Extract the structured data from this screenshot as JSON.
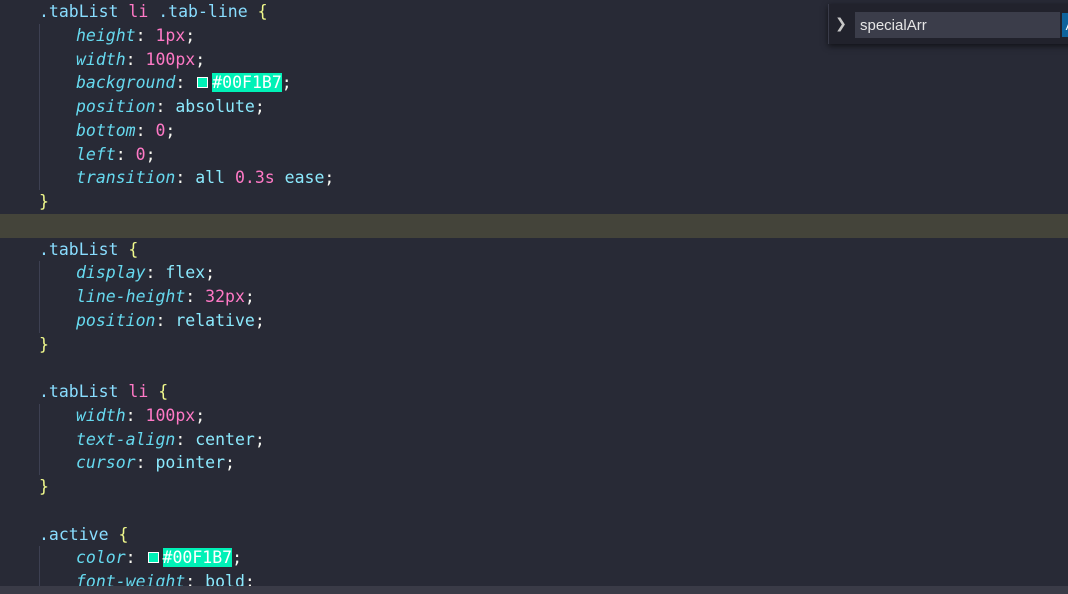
{
  "editor": {
    "lines": [
      {
        "indent": 1,
        "highlight": false,
        "tokens": [
          {
            "t": ".tabList",
            "c": "sel"
          },
          {
            "t": " ",
            "c": "punc"
          },
          {
            "t": "li",
            "c": "tag"
          },
          {
            "t": " ",
            "c": "punc"
          },
          {
            "t": ".tab-line",
            "c": "sel"
          },
          {
            "t": " ",
            "c": "punc"
          },
          {
            "t": "{",
            "c": "brace"
          }
        ]
      },
      {
        "indent": 2,
        "highlight": false,
        "tokens": [
          {
            "t": "height",
            "c": "prop"
          },
          {
            "t": ": ",
            "c": "punc"
          },
          {
            "t": "1px",
            "c": "num"
          },
          {
            "t": ";",
            "c": "punc"
          }
        ]
      },
      {
        "indent": 2,
        "highlight": false,
        "tokens": [
          {
            "t": "width",
            "c": "prop"
          },
          {
            "t": ": ",
            "c": "punc"
          },
          {
            "t": "100px",
            "c": "num"
          },
          {
            "t": ";",
            "c": "punc"
          }
        ]
      },
      {
        "indent": 2,
        "highlight": false,
        "tokens": [
          {
            "t": "background",
            "c": "prop"
          },
          {
            "t": ": ",
            "c": "punc"
          },
          {
            "t": "",
            "c": "swatch",
            "color": "#00F1B7"
          },
          {
            "t": "#00F1B7",
            "c": "colorval"
          },
          {
            "t": ";",
            "c": "punc"
          }
        ]
      },
      {
        "indent": 2,
        "highlight": false,
        "tokens": [
          {
            "t": "position",
            "c": "prop"
          },
          {
            "t": ": ",
            "c": "punc"
          },
          {
            "t": "absolute",
            "c": "kw"
          },
          {
            "t": ";",
            "c": "punc"
          }
        ]
      },
      {
        "indent": 2,
        "highlight": false,
        "tokens": [
          {
            "t": "bottom",
            "c": "prop"
          },
          {
            "t": ": ",
            "c": "punc"
          },
          {
            "t": "0",
            "c": "num"
          },
          {
            "t": ";",
            "c": "punc"
          }
        ]
      },
      {
        "indent": 2,
        "highlight": false,
        "tokens": [
          {
            "t": "left",
            "c": "prop"
          },
          {
            "t": ": ",
            "c": "punc"
          },
          {
            "t": "0",
            "c": "num"
          },
          {
            "t": ";",
            "c": "punc"
          }
        ]
      },
      {
        "indent": 2,
        "highlight": false,
        "tokens": [
          {
            "t": "transition",
            "c": "prop"
          },
          {
            "t": ": ",
            "c": "punc"
          },
          {
            "t": "all",
            "c": "kw"
          },
          {
            "t": " ",
            "c": "punc"
          },
          {
            "t": "0.3s",
            "c": "num"
          },
          {
            "t": " ",
            "c": "punc"
          },
          {
            "t": "ease",
            "c": "kw"
          },
          {
            "t": ";",
            "c": "punc"
          }
        ]
      },
      {
        "indent": 1,
        "highlight": false,
        "tokens": [
          {
            "t": "}",
            "c": "brace"
          }
        ]
      },
      {
        "indent": 0,
        "highlight": true,
        "tokens": []
      },
      {
        "indent": 1,
        "highlight": false,
        "tokens": [
          {
            "t": ".tabList",
            "c": "sel"
          },
          {
            "t": " ",
            "c": "punc"
          },
          {
            "t": "{",
            "c": "brace"
          }
        ]
      },
      {
        "indent": 2,
        "highlight": false,
        "tokens": [
          {
            "t": "display",
            "c": "prop"
          },
          {
            "t": ": ",
            "c": "punc"
          },
          {
            "t": "flex",
            "c": "kw"
          },
          {
            "t": ";",
            "c": "punc"
          }
        ]
      },
      {
        "indent": 2,
        "highlight": false,
        "tokens": [
          {
            "t": "line-height",
            "c": "prop"
          },
          {
            "t": ": ",
            "c": "punc"
          },
          {
            "t": "32px",
            "c": "num"
          },
          {
            "t": ";",
            "c": "punc"
          }
        ]
      },
      {
        "indent": 2,
        "highlight": false,
        "tokens": [
          {
            "t": "position",
            "c": "prop"
          },
          {
            "t": ": ",
            "c": "punc"
          },
          {
            "t": "relative",
            "c": "kw"
          },
          {
            "t": ";",
            "c": "punc"
          }
        ]
      },
      {
        "indent": 1,
        "highlight": false,
        "tokens": [
          {
            "t": "}",
            "c": "brace"
          }
        ]
      },
      {
        "indent": 0,
        "highlight": false,
        "tokens": []
      },
      {
        "indent": 1,
        "highlight": false,
        "tokens": [
          {
            "t": ".tabList",
            "c": "sel"
          },
          {
            "t": " ",
            "c": "punc"
          },
          {
            "t": "li",
            "c": "tag"
          },
          {
            "t": " ",
            "c": "punc"
          },
          {
            "t": "{",
            "c": "brace"
          }
        ]
      },
      {
        "indent": 2,
        "highlight": false,
        "tokens": [
          {
            "t": "width",
            "c": "prop"
          },
          {
            "t": ": ",
            "c": "punc"
          },
          {
            "t": "100px",
            "c": "num"
          },
          {
            "t": ";",
            "c": "punc"
          }
        ]
      },
      {
        "indent": 2,
        "highlight": false,
        "tokens": [
          {
            "t": "text-align",
            "c": "prop"
          },
          {
            "t": ": ",
            "c": "punc"
          },
          {
            "t": "center",
            "c": "kw"
          },
          {
            "t": ";",
            "c": "punc"
          }
        ]
      },
      {
        "indent": 2,
        "highlight": false,
        "tokens": [
          {
            "t": "cursor",
            "c": "prop"
          },
          {
            "t": ": ",
            "c": "punc"
          },
          {
            "t": "pointer",
            "c": "kw"
          },
          {
            "t": ";",
            "c": "punc"
          }
        ]
      },
      {
        "indent": 1,
        "highlight": false,
        "tokens": [
          {
            "t": "}",
            "c": "brace"
          }
        ]
      },
      {
        "indent": 0,
        "highlight": false,
        "tokens": []
      },
      {
        "indent": 1,
        "highlight": false,
        "tokens": [
          {
            "t": ".active",
            "c": "sel"
          },
          {
            "t": " ",
            "c": "punc"
          },
          {
            "t": "{",
            "c": "brace"
          }
        ]
      },
      {
        "indent": 2,
        "highlight": false,
        "tokens": [
          {
            "t": "color",
            "c": "prop"
          },
          {
            "t": ": ",
            "c": "punc"
          },
          {
            "t": "",
            "c": "swatch",
            "color": "#00F1B7"
          },
          {
            "t": "#00F1B7",
            "c": "colorval"
          },
          {
            "t": ";",
            "c": "punc"
          }
        ]
      },
      {
        "indent": 2,
        "highlight": false,
        "tokens": [
          {
            "t": "font-weight",
            "c": "prop"
          },
          {
            "t": ": ",
            "c": "punc"
          },
          {
            "t": "bold",
            "c": "kw"
          },
          {
            "t": ";",
            "c": "punc"
          }
        ]
      }
    ]
  },
  "find": {
    "query": "specialArr",
    "toggle_icon": "chevron-right-icon",
    "option_label": "A"
  },
  "theme": {
    "background": "#282a36",
    "highlight_line": "#44443a",
    "accent_color": "#00F1B7"
  }
}
